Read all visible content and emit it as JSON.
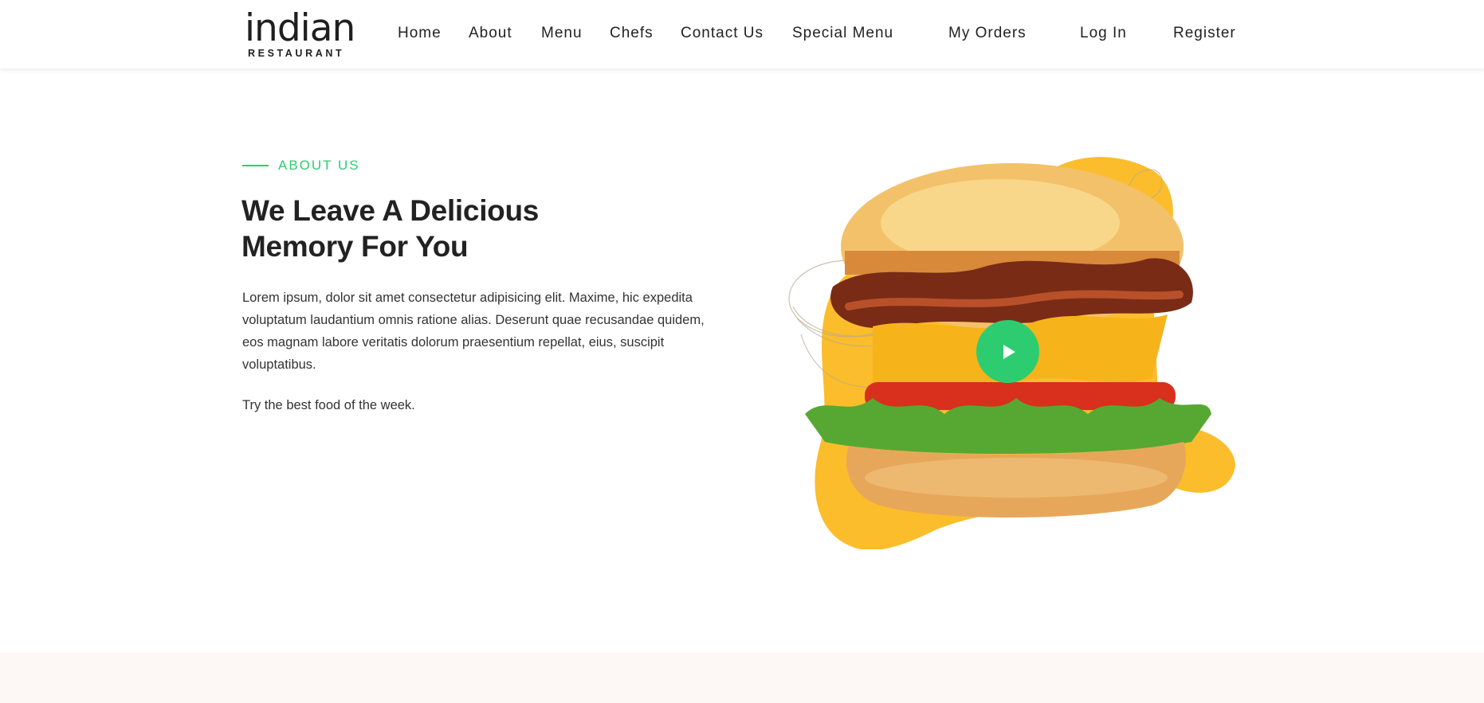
{
  "brand": {
    "name": "indian",
    "tagline": "RESTAURANT"
  },
  "nav": {
    "items": [
      {
        "label": "Home"
      },
      {
        "label": "About"
      },
      {
        "label": "Menu"
      },
      {
        "label": "Chefs"
      },
      {
        "label": "Contact Us"
      },
      {
        "label": "Special Menu"
      },
      {
        "label": "My Orders"
      },
      {
        "label": "Log In"
      },
      {
        "label": "Register"
      }
    ]
  },
  "about": {
    "eyebrow": "ABOUT US",
    "headline_line1": "We Leave A Delicious",
    "headline_line2": "Memory For You",
    "paragraph": "Lorem ipsum, dolor sit amet consectetur adipisicing elit. Maxime, hic expedita voluptatum laudantium omnis ratione alias. Deserunt quae recusandae quidem, eos magnam labore veritatis dolorum praesentium repellat, eius, suscipit voluptatibus.",
    "tagline": "Try the best food of the week."
  },
  "media": {
    "play_icon": "play-icon"
  },
  "colors": {
    "accent": "#2ecc71",
    "blob": "#fbbd2c",
    "text": "#222222",
    "section_bg": "#fdf7f5"
  }
}
